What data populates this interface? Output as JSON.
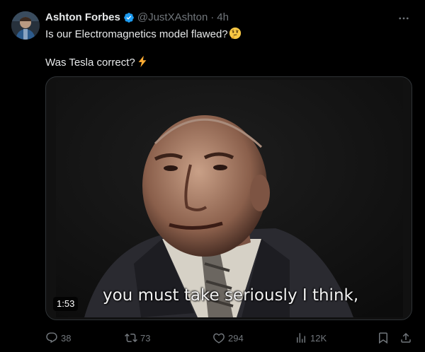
{
  "tweet": {
    "display_name": "Ashton Forbes",
    "handle": "@JustXAshton",
    "separator": "·",
    "time": "4h",
    "line1": "Is our Electromagnetics model flawed?",
    "line2": "Was Tesla correct?",
    "emoji1": "thinking-face-emoji",
    "emoji2": "lightning-emoji"
  },
  "media": {
    "subtitle": "you must take seriously I think,",
    "duration": "1:53"
  },
  "actions": {
    "replies": "38",
    "reposts": "73",
    "likes": "294",
    "views": "12K"
  },
  "colors": {
    "background": "#000000",
    "text": "#e7e9ea",
    "secondary": "#71767b",
    "verified": "#1d9bf0",
    "border": "#2f3336"
  }
}
